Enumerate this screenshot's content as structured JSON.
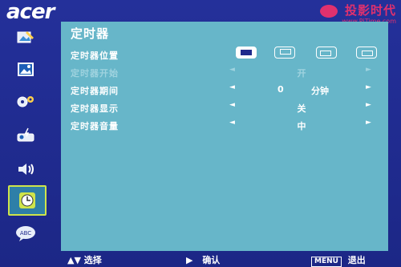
{
  "brand": {
    "logo": "acer"
  },
  "watermark": {
    "title": "投影时代",
    "url": "www.PjTime.com"
  },
  "sidebar": {
    "items": [
      {
        "icon": "picture-brush-icon"
      },
      {
        "icon": "image-settings-icon"
      },
      {
        "icon": "gears-icon"
      },
      {
        "icon": "projector-settings-icon"
      },
      {
        "icon": "speaker-volume-icon"
      },
      {
        "icon": "clock-icon",
        "active": true
      },
      {
        "icon": "language-speech-icon",
        "text": "ABC"
      }
    ]
  },
  "panel": {
    "title": "定时器",
    "rows": {
      "position": {
        "label": "定时器位置"
      },
      "start": {
        "label": "定时器开始",
        "value": "开"
      },
      "duration": {
        "label": "定时器期间",
        "value": "0",
        "unit": "分钟"
      },
      "display": {
        "label": "定时器显示",
        "value": "关"
      },
      "volume": {
        "label": "定时器音量",
        "value": "中"
      }
    }
  },
  "footer": {
    "select": "选择",
    "confirm": "确认",
    "menu_key": "MENU",
    "exit": "退出"
  },
  "colors": {
    "background": "#1f2a8c",
    "panel": "#67b6c9",
    "active_border": "#cfe44a",
    "watermark": "#e0316e"
  }
}
